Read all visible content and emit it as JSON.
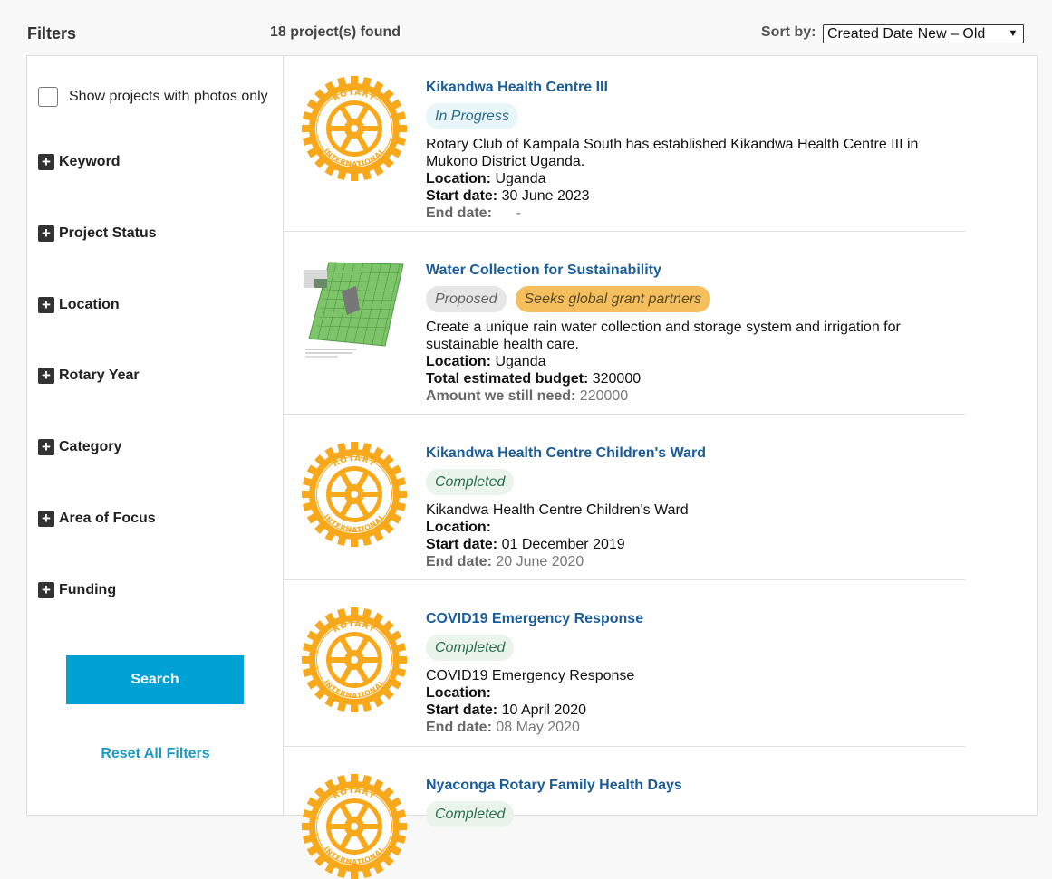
{
  "header": {
    "filters_title": "Filters",
    "results_count": "18 project(s) found",
    "sort_label": "Sort by:",
    "sort_value": "Created Date New – Old"
  },
  "sidebar": {
    "photos_only_label": "Show projects with photos only",
    "filters": [
      "Keyword",
      "Project Status",
      "Location",
      "Rotary Year",
      "Category",
      "Area of Focus",
      "Funding"
    ],
    "search_label": "Search",
    "reset_label": "Reset All Filters"
  },
  "logo_text": {
    "top": "ROTARY",
    "bottom": "INTERNATIONAL"
  },
  "projects": [
    {
      "title": "Kikandwa Health Centre III",
      "badges": [
        "In Progress"
      ],
      "description": "Rotary Club of Kampala South has established Kikandwa Health Centre III in Mukono District Uganda.",
      "location_label": "Location:",
      "location": "Uganda",
      "start_label": "Start date:",
      "start": "30 June 2023",
      "end_label": "End date:",
      "end": "     -"
    },
    {
      "title": "Water Collection for Sustainability",
      "badges": [
        "Proposed",
        "Seeks global grant partners"
      ],
      "description": "Create a unique rain water collection and storage system and irrigation for sustainable health care.",
      "location_label": "Location:",
      "location": "Uganda",
      "budget_label": "Total estimated budget:",
      "budget": "320000",
      "need_label": "Amount we still need:",
      "need": "220000"
    },
    {
      "title": "Kikandwa Health Centre Children's Ward",
      "badges": [
        "Completed"
      ],
      "description": "Kikandwa Health Centre Children's Ward",
      "location_label": "Location:",
      "location": "",
      "start_label": "Start date:",
      "start": "01 December 2019",
      "end_label": "End date:",
      "end": "20 June 2020"
    },
    {
      "title": "COVID19 Emergency Response",
      "badges": [
        "Completed"
      ],
      "description": "COVID19 Emergency Response",
      "location_label": "Location:",
      "location": "",
      "start_label": "Start date:",
      "start": "10 April 2020",
      "end_label": "End date:",
      "end": "08 May 2020"
    },
    {
      "title": "Nyaconga Rotary Family Health Days",
      "badges": [
        "Completed"
      ]
    }
  ],
  "colors": {
    "link_blue": "#1a5d98",
    "search_button": "#00a2d4",
    "rotary_gold": "#f7a81b",
    "seeks_badge": "#f5bf5e"
  },
  "icons": [
    "checkbox-icon",
    "plus-icon",
    "chevron-down-icon",
    "rotary-wheel-icon"
  ]
}
